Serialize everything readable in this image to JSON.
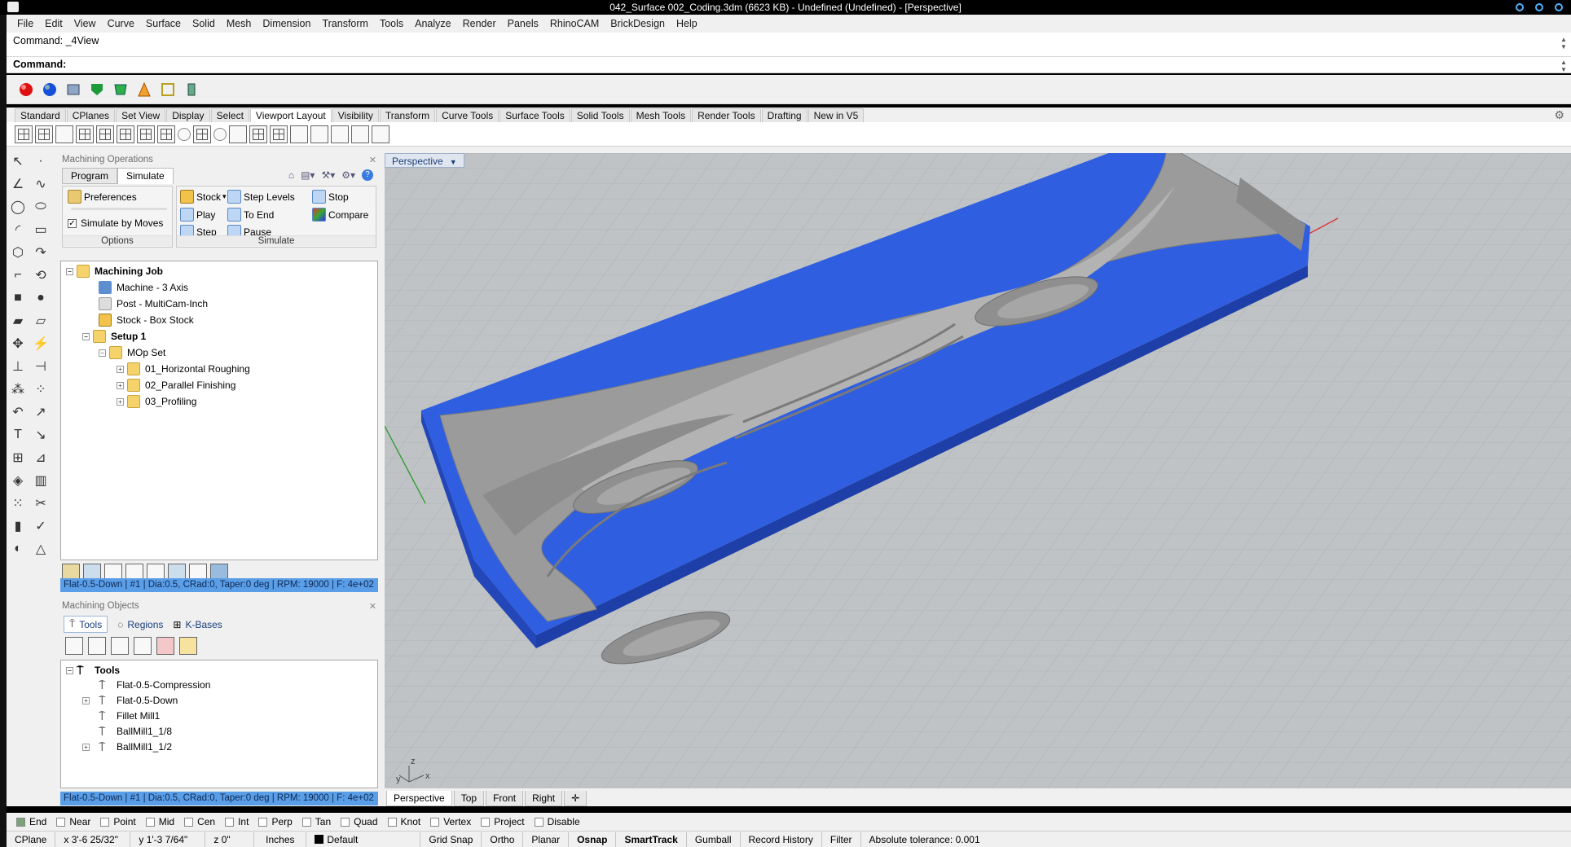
{
  "window": {
    "title": "042_Surface 002_Coding.3dm (6623 KB) - Undefined (Undefined) - [Perspective]"
  },
  "menu": [
    "File",
    "Edit",
    "View",
    "Curve",
    "Surface",
    "Solid",
    "Mesh",
    "Dimension",
    "Transform",
    "Tools",
    "Analyze",
    "Render",
    "Panels",
    "RhinoCAM",
    "BrickDesign",
    "Help"
  ],
  "command": {
    "history": "Command: _4View",
    "prompt": "Command:"
  },
  "toolbar_tabs": [
    "Standard",
    "CPlanes",
    "Set View",
    "Display",
    "Select",
    "Viewport Layout",
    "Visibility",
    "Transform",
    "Curve Tools",
    "Surface Tools",
    "Solid Tools",
    "Mesh Tools",
    "Render Tools",
    "Drafting",
    "New in V5"
  ],
  "toolbar_tab_active": "Viewport Layout",
  "machining_ops": {
    "title": "Machining Operations",
    "tabs": [
      "Program",
      "Simulate"
    ],
    "options_group": {
      "preferences": "Preferences",
      "simulate_by_moves": "Simulate by Moves",
      "label": "Options"
    },
    "simulate_group": {
      "stock": "Stock",
      "step_levels": "Step Levels",
      "stop": "Stop",
      "play": "Play",
      "to_end": "To End",
      "compare": "Compare",
      "step": "Step",
      "pause": "Pause",
      "label": "Simulate"
    },
    "tree": {
      "root": "Machining Job",
      "machine": "Machine - 3 Axis",
      "post": "Post - MultiCam-Inch",
      "stock": "Stock - Box Stock",
      "setup": "Setup 1",
      "mopset": "MOp Set",
      "ops": [
        "01_Horizontal Roughing",
        "02_Parallel Finishing",
        "03_Profiling"
      ]
    },
    "status": "Flat-0.5-Down | #1 | Dia:0.5, CRad:0, Taper:0 deg | RPM: 19000 | F: 4e+02"
  },
  "machining_objs": {
    "title": "Machining Objects",
    "tabs": [
      "Tools",
      "Regions",
      "K-Bases"
    ],
    "tree": {
      "root": "Tools",
      "items": [
        "Flat-0.5-Compression",
        "Flat-0.5-Down",
        "Fillet Mill1",
        "BallMill1_1/8",
        "BallMill1_1/2"
      ]
    },
    "status": "Flat-0.5-Down | #1 | Dia:0.5, CRad:0, Taper:0 deg | RPM: 19000 | F: 4e+02"
  },
  "viewport": {
    "label": "Perspective",
    "tabs": [
      "Perspective",
      "Top",
      "Front",
      "Right"
    ],
    "axis_x": "x",
    "axis_y": "y",
    "axis_z": "z"
  },
  "osnaps": [
    {
      "label": "End",
      "on": true
    },
    {
      "label": "Near",
      "on": false
    },
    {
      "label": "Point",
      "on": false
    },
    {
      "label": "Mid",
      "on": false
    },
    {
      "label": "Cen",
      "on": false
    },
    {
      "label": "Int",
      "on": false
    },
    {
      "label": "Perp",
      "on": false
    },
    {
      "label": "Tan",
      "on": false
    },
    {
      "label": "Quad",
      "on": false
    },
    {
      "label": "Knot",
      "on": false
    },
    {
      "label": "Vertex",
      "on": false
    },
    {
      "label": "Project",
      "on": false
    },
    {
      "label": "Disable",
      "on": false
    }
  ],
  "status": {
    "cplane": "CPlane",
    "x": "x 3'-6 25/32\"",
    "y": "y 1'-3 7/64\"",
    "z": "z 0\"",
    "units": "Inches",
    "layer": "Default",
    "grid_snap": "Grid Snap",
    "ortho": "Ortho",
    "planar": "Planar",
    "osnap": "Osnap",
    "smarttrack": "SmartTrack",
    "gumball": "Gumball",
    "record_history": "Record History",
    "filter": "Filter",
    "tolerance": "Absolute tolerance: 0.001"
  },
  "colors": {
    "stock_blue": "#2f5fe0",
    "model_gray": "#9a9a9a",
    "viewport_bg": "#bfc3c6"
  }
}
